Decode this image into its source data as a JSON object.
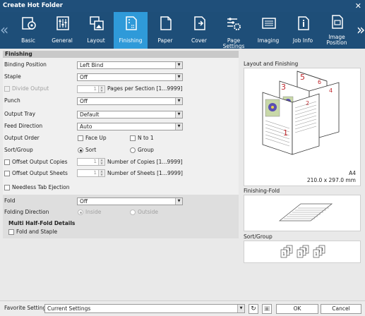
{
  "window": {
    "title": "Create Hot Folder"
  },
  "tabs": [
    {
      "label": "Basic",
      "icon": "basic-icon"
    },
    {
      "label": "General",
      "icon": "general-icon"
    },
    {
      "label": "Layout",
      "icon": "layout-icon"
    },
    {
      "label": "Finishing",
      "icon": "finishing-icon"
    },
    {
      "label": "Paper",
      "icon": "paper-icon"
    },
    {
      "label": "Cover",
      "icon": "cover-icon"
    },
    {
      "label": "Page Settings",
      "icon": "page-settings-icon"
    },
    {
      "label": "Imaging",
      "icon": "imaging-icon"
    },
    {
      "label": "Job Info",
      "icon": "job-info-icon"
    },
    {
      "label": "Image Position",
      "icon": "image-position-icon"
    }
  ],
  "finishing": {
    "section_title": "Finishing",
    "binding_position": {
      "label": "Binding Position",
      "value": "Left Bind"
    },
    "staple": {
      "label": "Staple",
      "value": "Off"
    },
    "divide_output": {
      "label": "Divide Output",
      "value": "1",
      "unit": "Pages per Section [1...9999]"
    },
    "punch": {
      "label": "Punch",
      "value": "Off"
    },
    "output_tray": {
      "label": "Output Tray",
      "value": "Default"
    },
    "feed_direction": {
      "label": "Feed Direction",
      "value": "Auto"
    },
    "output_order": {
      "label": "Output Order",
      "face_up": "Face Up",
      "n_to_1": "N to 1"
    },
    "sort_group": {
      "label": "Sort/Group",
      "sort": "Sort",
      "group": "Group"
    },
    "offset_copies": {
      "label": "Offset Output Copies",
      "value": "1",
      "unit": "Number of Copies [1...9999]"
    },
    "offset_sheets": {
      "label": "Offset Output Sheets",
      "value": "1",
      "unit": "Number of Sheets [1...9999]"
    },
    "needless_tab": {
      "label": "Needless Tab Ejection"
    },
    "fold": {
      "label": "Fold",
      "value": "Off"
    },
    "folding_direction": {
      "label": "Folding Direction",
      "inside": "Inside",
      "outside": "Outside"
    },
    "multi_half_fold": {
      "title": "Multi Half-Fold Details",
      "fold_and_staple": "Fold and Staple"
    }
  },
  "preview": {
    "layout_title": "Layout and Finishing",
    "paper_size": "A4",
    "paper_dims": "210.0 x 297.0 mm",
    "page_numbers": [
      "1",
      "2",
      "3",
      "4",
      "5",
      "6"
    ],
    "fold_title": "Finishing-Fold",
    "sort_title": "Sort/Group",
    "sort_digits": [
      "1",
      "2",
      "3"
    ]
  },
  "footer": {
    "favorite_label": "Favorite Setting",
    "favorite_value": "Current Settings",
    "ok": "OK",
    "cancel": "Cancel"
  },
  "colors": {
    "title_bar": "#1f4f7a",
    "active_tab": "#2f9ad9",
    "page_number": "#c0282d",
    "flower": "#5a4fb3"
  }
}
